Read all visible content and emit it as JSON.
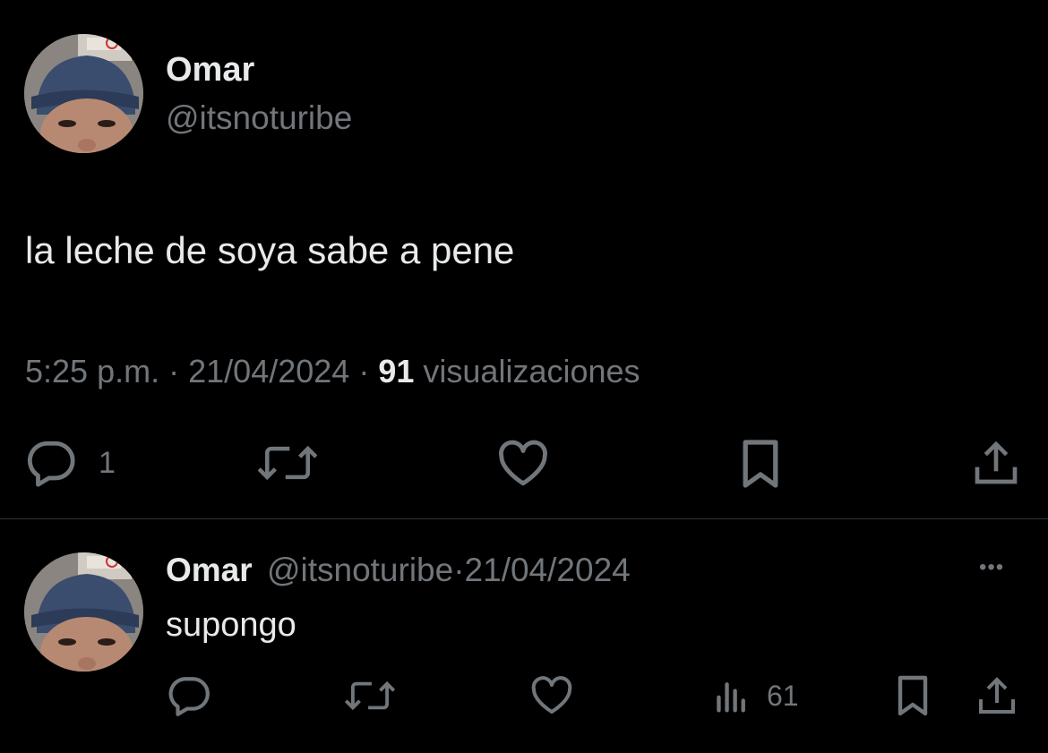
{
  "main_tweet": {
    "author_name": "Omar",
    "author_handle": "@itsnoturibe",
    "text": "la leche de soya sabe a pene",
    "time": "5:25 p.m.",
    "sep1": "·",
    "date": "21/04/2024",
    "sep2": "·",
    "views_count": "91",
    "views_label": "visualizaciones",
    "actions": {
      "reply_count": "1",
      "icons": [
        "reply-icon",
        "retweet-icon",
        "like-icon",
        "bookmark-icon",
        "share-icon"
      ]
    }
  },
  "reply_tweet": {
    "author_name": "Omar",
    "author_handle": "@itsnoturibe",
    "sep": "·",
    "date": "21/04/2024",
    "more_label": "•••",
    "text": "supongo",
    "views_count": "61",
    "icons": [
      "reply-icon",
      "retweet-icon",
      "like-icon",
      "views-icon",
      "bookmark-icon",
      "share-icon"
    ]
  },
  "colors": {
    "background": "#000000",
    "text": "#e7e9ea",
    "muted": "#71767b",
    "divider": "#2f3336"
  }
}
